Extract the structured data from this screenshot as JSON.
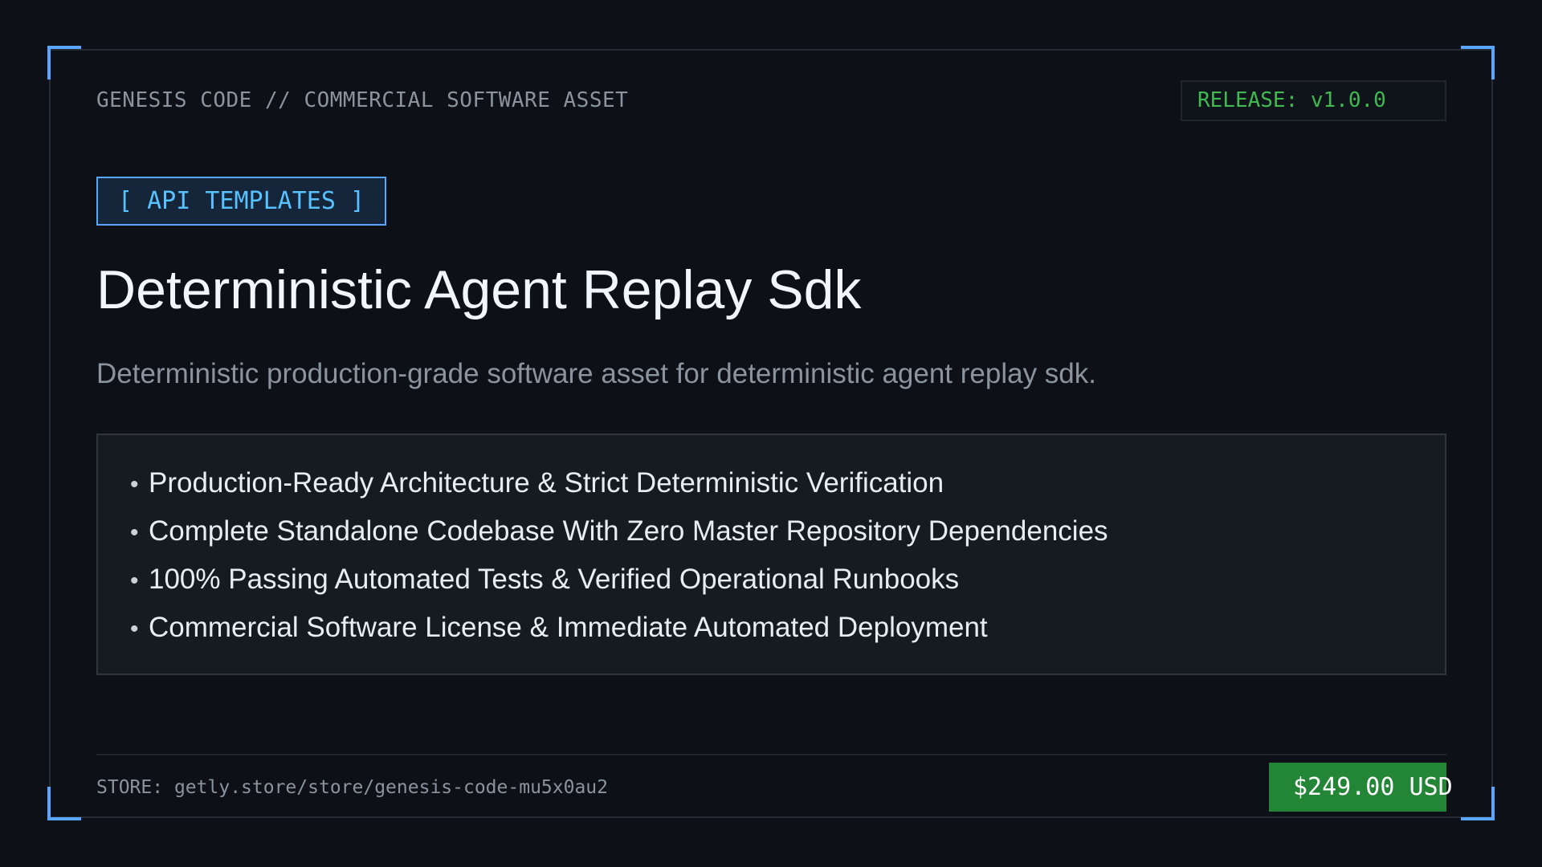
{
  "header": {
    "label": "GENESIS CODE // COMMERCIAL SOFTWARE ASSET",
    "release": "RELEASE: v1.0.0"
  },
  "product": {
    "category": "[ API TEMPLATES ]",
    "title": "Deterministic Agent Replay Sdk",
    "description": "Deterministic production-grade software asset for deterministic agent replay sdk."
  },
  "features": {
    "bullet": "•",
    "items": [
      "Production-Ready Architecture & Strict Deterministic Verification",
      "Complete Standalone Codebase With Zero Master Repository Dependencies",
      "100% Passing Automated Tests & Verified Operational Runbooks",
      "Commercial Software License & Immediate Automated Deployment"
    ]
  },
  "footer": {
    "store_label": "STORE:",
    "store_url": "getly.store/store/genesis-code-mu5x0au2",
    "price": "$249.00 USD"
  },
  "colors": {
    "background": "#0d1117",
    "accent": "#58a6ff",
    "release_green": "#3fb950",
    "price_green": "#238636"
  }
}
